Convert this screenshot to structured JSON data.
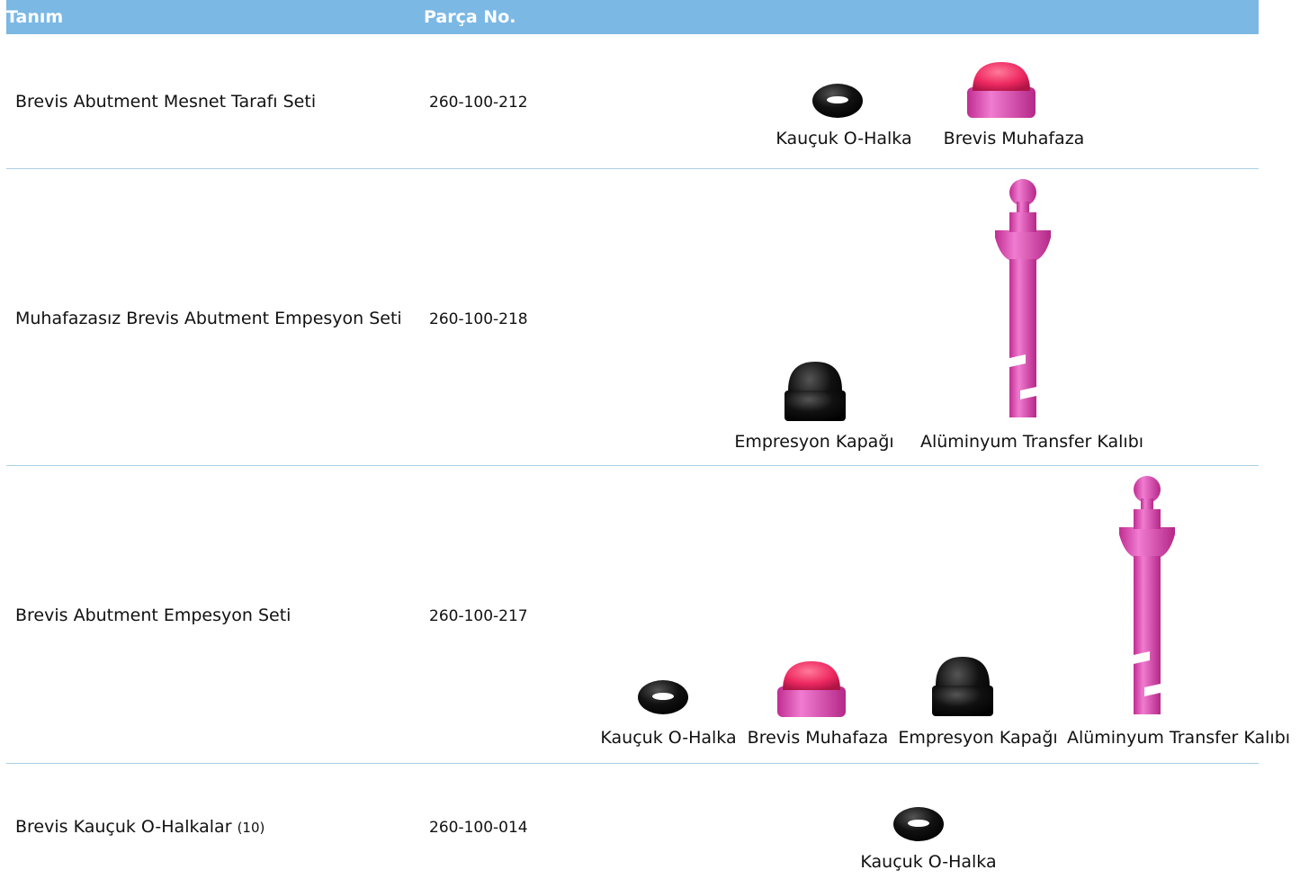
{
  "header": {
    "col_desc": "Tanım",
    "col_part": "Parça No."
  },
  "rows": [
    {
      "description": "Brevis Abutment Mesnet Tarafı Seti",
      "qty": "",
      "part_no": "260-100-212",
      "items": [
        "Kauçuk O-Halka",
        "Brevis Muhafaza"
      ]
    },
    {
      "description": "Muhafazasız Brevis Abutment Empesyon Seti",
      "qty": "",
      "part_no": "260-100-218",
      "items": [
        "Empresyon Kapağı",
        "Alüminyum Transfer Kalıbı"
      ]
    },
    {
      "description": "Brevis Abutment Empesyon Seti",
      "qty": "",
      "part_no": "260-100-217",
      "items": [
        "Kauçuk O-Halka",
        "Brevis Muhafaza",
        "Empresyon Kapağı",
        "Alüminyum Transfer Kalıbı"
      ]
    },
    {
      "description": "Brevis Kauçuk O-Halkalar",
      "qty": "(10)",
      "part_no": "260-100-014",
      "items": [
        "Kauçuk O-Halka"
      ]
    }
  ],
  "colors": {
    "header_bg": "#7bb8e4",
    "divider": "#a9cfe6",
    "pink": "#e64fb8",
    "red_top": "#f0306a",
    "black": "#111111"
  }
}
